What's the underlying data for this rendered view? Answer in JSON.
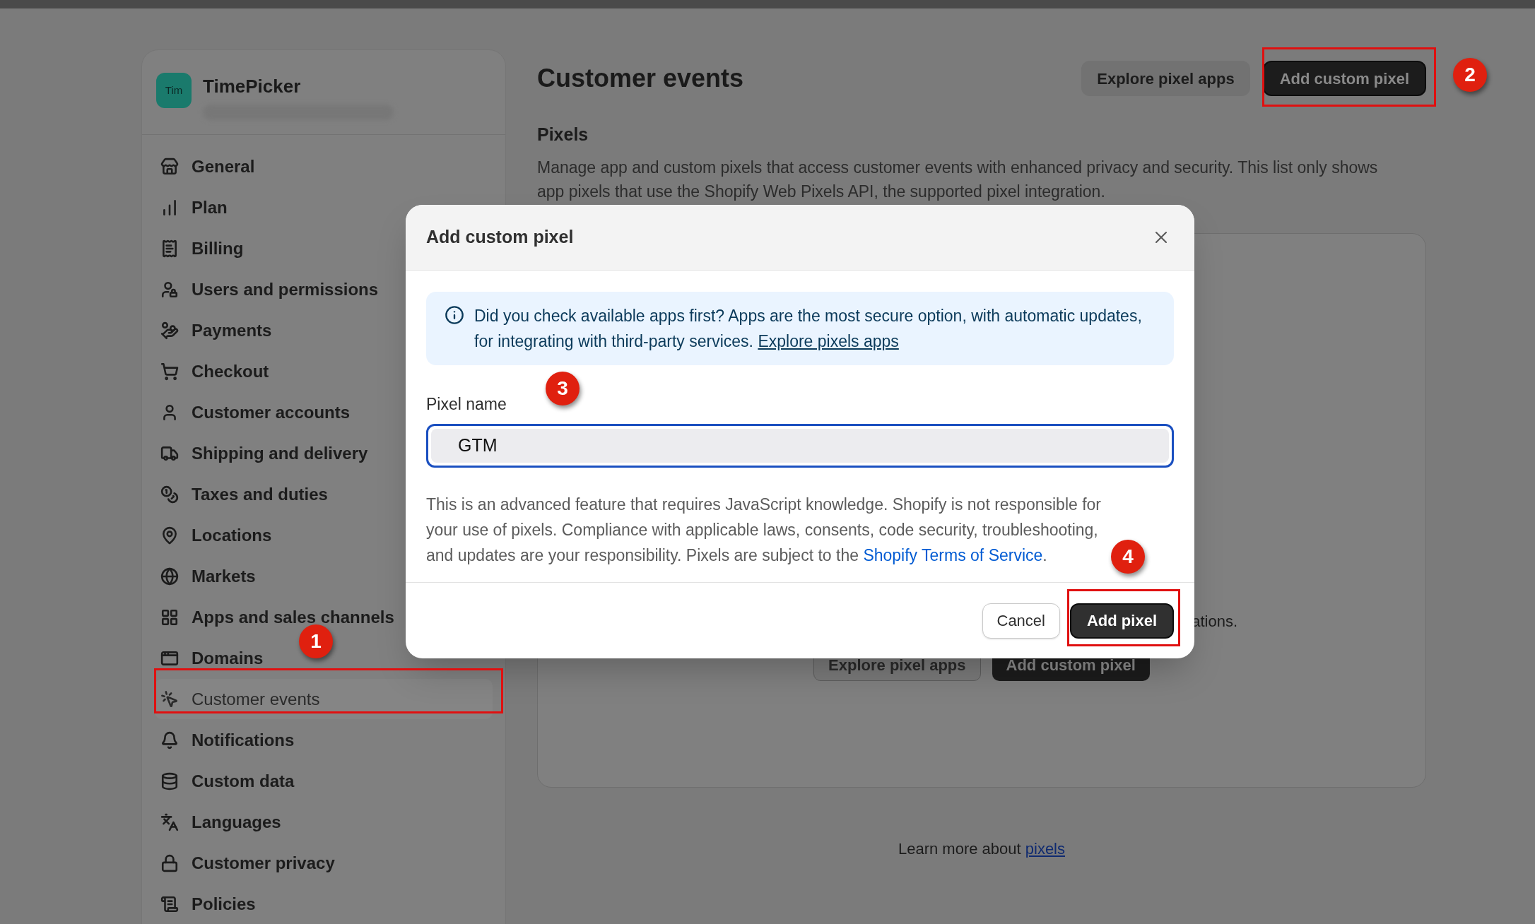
{
  "store": {
    "avatar": "Tim",
    "name": "TimePicker"
  },
  "sidebar": {
    "items": [
      {
        "label": "General",
        "selected": false
      },
      {
        "label": "Plan",
        "selected": false
      },
      {
        "label": "Billing",
        "selected": false
      },
      {
        "label": "Users and permissions",
        "selected": false
      },
      {
        "label": "Payments",
        "selected": false
      },
      {
        "label": "Checkout",
        "selected": false
      },
      {
        "label": "Customer accounts",
        "selected": false
      },
      {
        "label": "Shipping and delivery",
        "selected": false
      },
      {
        "label": "Taxes and duties",
        "selected": false
      },
      {
        "label": "Locations",
        "selected": false
      },
      {
        "label": "Markets",
        "selected": false
      },
      {
        "label": "Apps and sales channels",
        "selected": false
      },
      {
        "label": "Domains",
        "selected": false
      },
      {
        "label": "Customer events",
        "selected": true
      },
      {
        "label": "Notifications",
        "selected": false
      },
      {
        "label": "Custom data",
        "selected": false
      },
      {
        "label": "Languages",
        "selected": false
      },
      {
        "label": "Customer privacy",
        "selected": false
      },
      {
        "label": "Policies",
        "selected": false
      }
    ]
  },
  "page": {
    "title": "Customer events",
    "buttons": [
      "Explore pixel apps",
      "Add custom pixel"
    ],
    "section_title": "Pixels",
    "description": "Manage app and custom pixels that access customer events with enhanced privacy and security. This list only shows app pixels that use the Shopify Web Pixels API, the supported pixel integration.",
    "card_text": "ations.",
    "card_buttons": [
      "Explore pixel apps",
      "Add custom pixel"
    ],
    "footer_text": "Learn more about",
    "footer_link": "pixels"
  },
  "dialog": {
    "title": "Add custom pixel",
    "notice": "Did you check available apps first? Apps are the most secure option, with automatic updates, for integrating with third-party services.",
    "notice_link": "Explore pixels apps",
    "field": {
      "label": "Pixel name",
      "value": "GTM"
    },
    "disclaimer": "This is an advanced feature that requires JavaScript knowledge. Shopify is not responsible for your use of pixels. Compliance with applicable laws, consents, code security, troubleshooting, and updates are your responsibility. Pixels are subject to the",
    "disclaimer_link": "Shopify Terms of Service",
    "disclaimer_end": ".",
    "buttons": [
      "Cancel",
      "Add pixel"
    ]
  },
  "annotations": [
    {
      "label": "1"
    },
    {
      "label": "2"
    },
    {
      "label": "3"
    },
    {
      "label": "4"
    }
  ]
}
